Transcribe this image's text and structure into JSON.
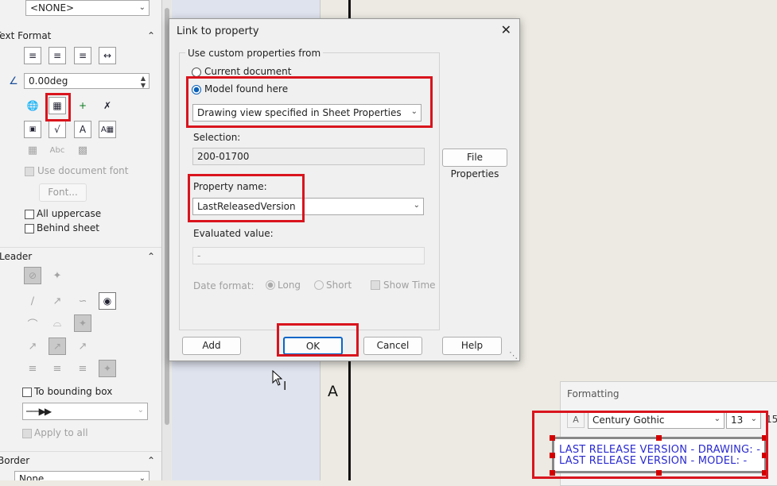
{
  "left_panel": {
    "layer_combo": "<NONE>",
    "text_format": {
      "header": "Text Format",
      "angle_value": "0.00deg",
      "use_document_font": "Use document font",
      "font_button": "Font...",
      "all_uppercase": "All uppercase",
      "behind_sheet": "Behind sheet"
    },
    "leader": {
      "header": "Leader",
      "to_bounding_box": "To bounding box",
      "apply_to_all": "Apply to all"
    },
    "border": {
      "header": "Border",
      "style_combo": "None"
    }
  },
  "drawing": {
    "zone_letter": "A"
  },
  "dialog": {
    "title": "Link to property",
    "group_label": "Use custom properties from",
    "radio_current": "Current document",
    "radio_model": "Model found here",
    "model_source_combo": "Drawing view specified in Sheet Properties",
    "selection_label": "Selection:",
    "selection_value": "200-01700",
    "file_properties_button": "File Properties",
    "property_name_label": "Property name:",
    "property_name_value": "LastReleasedVersion",
    "evaluated_value_label": "Evaluated value:",
    "evaluated_value": "-",
    "date_format_label": "Date format:",
    "date_long": "Long",
    "date_short": "Short",
    "show_time": "Show Time",
    "add_button": "Add",
    "ok_button": "OK",
    "cancel_button": "Cancel",
    "help_button": "Help"
  },
  "formatting_panel": {
    "title": "Formatting",
    "font_name": "Century Gothic",
    "font_size": "13",
    "extra_value": "15"
  },
  "note_text": {
    "line1": "LAST RELEASE VERSION - DRAWING: -",
    "line2": "LAST RELEASE VERSION - MODEL: -"
  },
  "colors": {
    "highlight": "#d9141d",
    "note_text": "#2a2ad0",
    "primary_button_border": "#0a66c8"
  }
}
